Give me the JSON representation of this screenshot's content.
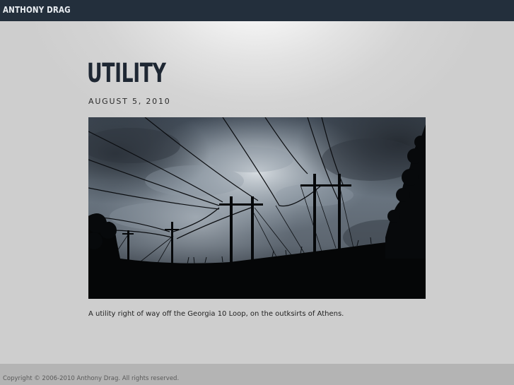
{
  "site": {
    "title": "ANTHONY DRAG"
  },
  "post": {
    "title": "UTILITY",
    "date": "AUGUST 5, 2010",
    "caption": "A utility right of way off the Georgia 10 Loop, on the outksirts of Athens."
  },
  "footer": {
    "copyright": "Copyright © 2006-2010 Anthony Drag. All rights reserved."
  },
  "colors": {
    "topbar": "#232f3c",
    "footer": "#b4b4b4",
    "background": "#cfcfcf"
  },
  "image": {
    "subject": "silhouetted utility poles and power lines against a cloudy sky"
  }
}
